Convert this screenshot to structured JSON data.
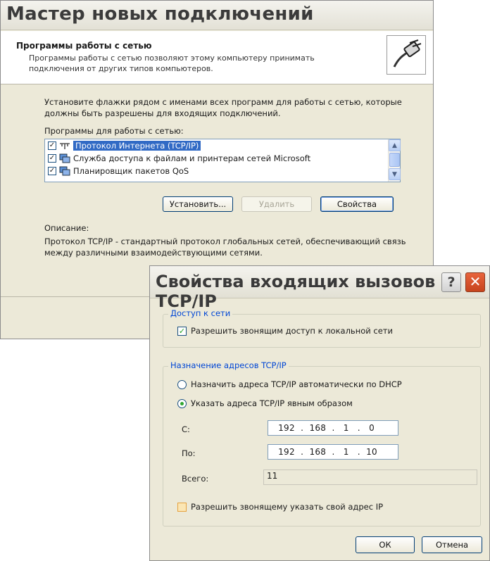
{
  "wizard": {
    "title": "Мастер новых подключений",
    "header_title": "Программы работы с сетью",
    "header_desc": "Программы работы с сетью позволяют этому компьютеру принимать подключения от других типов компьютеров.",
    "instruction": "Установите флажки рядом с именами всех программ для работы с сетью, которые должны быть разрешены для входящих подключений.",
    "programs_label": "Программы для работы с сетью:",
    "programs": [
      {
        "label": "Протокол Интернета (TCP/IP)",
        "checked": true,
        "selected": true,
        "icon": "network-protocol-icon"
      },
      {
        "label": "Служба доступа к файлам и принтерам сетей Microsoft",
        "checked": true,
        "selected": false,
        "icon": "network-service-icon"
      },
      {
        "label": "Планировщик пакетов QoS",
        "checked": true,
        "selected": false,
        "icon": "network-service-icon"
      }
    ],
    "install_button": "Установить...",
    "remove_button": "Удалить",
    "properties_button": "Свойства",
    "description_label": "Описание:",
    "description_text": "Протокол TCP/IP - стандартный протокол глобальных сетей, обеспечивающий связь между различными взаимодействующими сетями."
  },
  "dialog": {
    "title": "Свойства входящих вызовов TCP/IP",
    "help_button": "?",
    "close_button": "✕",
    "network_access_group": "Доступ к сети",
    "allow_lan_access": "Разрешить звонящим доступ к локальной сети",
    "allow_lan_checked": true,
    "ip_assignment_group": "Назначение адресов TCP/IP",
    "dhcp_option": "Назначить адреса TCP/IP автоматически по DHCP",
    "manual_option": "Указать адреса TCP/IP явным образом",
    "selected_option": "manual",
    "from_label": "С:",
    "from_ip": [
      "192",
      "168",
      "1",
      "0"
    ],
    "to_label": "По:",
    "to_ip": [
      "192",
      "168",
      "1",
      "10"
    ],
    "total_label": "Всего:",
    "total_value": "11",
    "allow_own_ip": "Разрешить звонящему указать свой адрес IP",
    "allow_own_ip_checked": false,
    "ok_button": "ОК",
    "cancel_button": "Отмена"
  },
  "colors": {
    "window_bg": "#ece9d8",
    "selection": "#316ac5",
    "group_legend": "#0046d5",
    "close_button": "#c7441d"
  }
}
